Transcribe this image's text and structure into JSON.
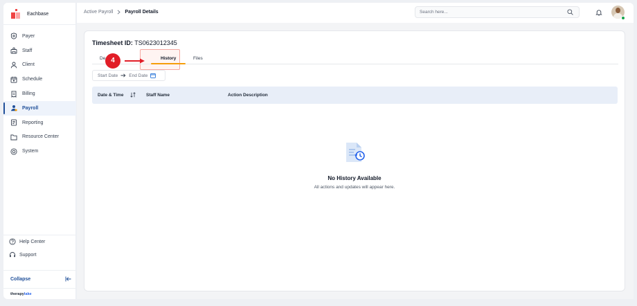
{
  "app": {
    "brand": "Eachbase"
  },
  "sidebar": {
    "items": [
      {
        "label": "Payer",
        "icon": "shield-icon"
      },
      {
        "label": "Staff",
        "icon": "staff-icon"
      },
      {
        "label": "Client",
        "icon": "user-icon"
      },
      {
        "label": "Schedule",
        "icon": "calendar-icon"
      },
      {
        "label": "Billing",
        "icon": "billing-icon"
      },
      {
        "label": "Payroll",
        "icon": "payroll-icon",
        "active": true
      },
      {
        "label": "Reporting",
        "icon": "report-icon"
      },
      {
        "label": "Resource Center",
        "icon": "folder-icon"
      },
      {
        "label": "System",
        "icon": "system-icon"
      }
    ],
    "help_label": "Help Center",
    "support_label": "Support",
    "collapse_label": "Collapse",
    "footer_brand_a": "therapy",
    "footer_brand_b": "lake"
  },
  "header": {
    "breadcrumb_parent": "Active Payroll",
    "breadcrumb_current": "Payroll Details",
    "search_placeholder": "Search here..."
  },
  "main": {
    "title_prefix": "Timesheet ID:",
    "title_id": "TS0623012345",
    "tabs": [
      {
        "label": "De"
      },
      {
        "label": "History",
        "active": true
      },
      {
        "label": "Files"
      }
    ],
    "step_number": "4",
    "date_start": "Start Date",
    "date_end": "End Date",
    "table_headers": [
      "Date & Time",
      "Staff Name",
      "Action Description"
    ],
    "empty_title": "No History Available",
    "empty_subtitle": "All actions and updates will appear here."
  },
  "colors": {
    "accent": "#1f4f99",
    "tab_underline": "#f59e0b",
    "step_badge": "#e11d27",
    "table_header_bg": "#e8eef8"
  }
}
